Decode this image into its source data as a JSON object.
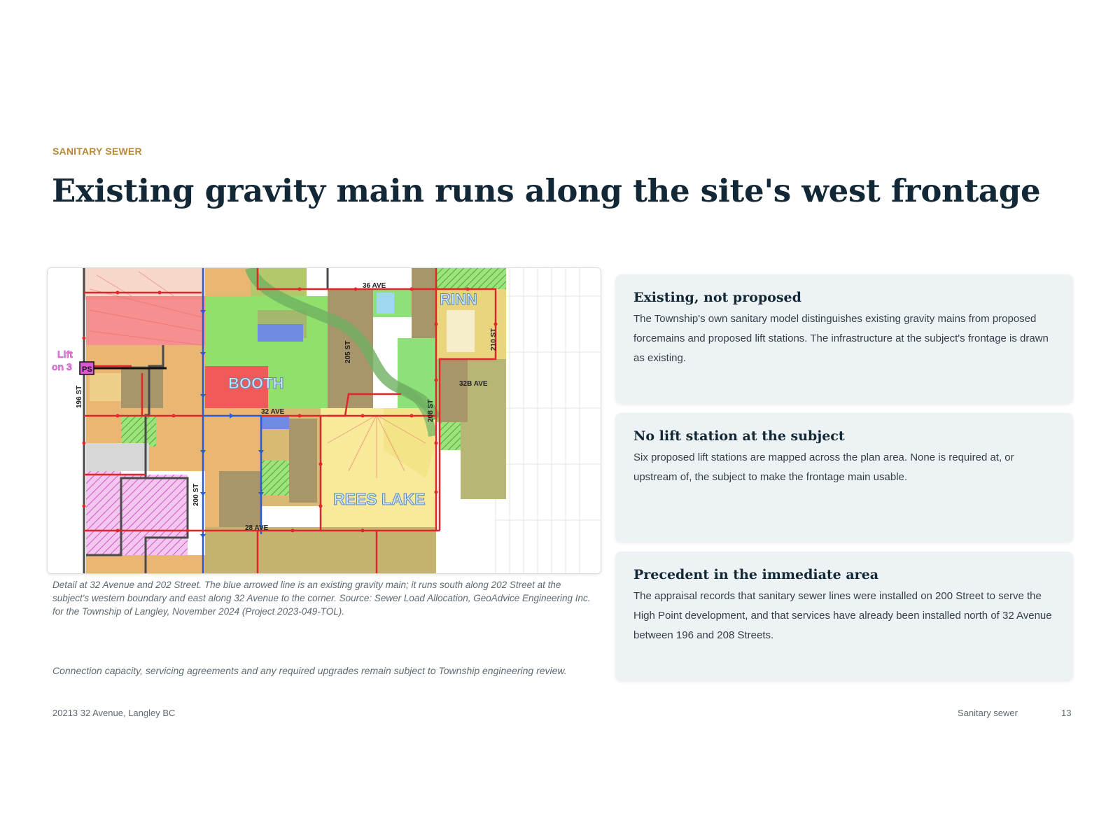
{
  "header": {
    "eyebrow": "SANITARY SEWER",
    "title": "Existing gravity main runs along the site's west frontage"
  },
  "map": {
    "labels": {
      "ave36": "36 AVE",
      "rinn": "RINN",
      "st210": "210 ST",
      "st205": "205 ST",
      "booth": "BOOTH",
      "ave32b": "32B AVE",
      "ave32": "32 AVE",
      "st208": "208 ST",
      "st196": "196 ST",
      "lift1": "Lift",
      "lift2": "on 3",
      "ps": "PS",
      "st200": "200 ST",
      "reesLake": "REES LAKE",
      "ave28": "28 AVE"
    },
    "caption": "Detail at 32 Avenue and 202 Street. The blue arrowed line is an existing gravity main; it runs south along 202 Street at the subject's western boundary and east along 32 Avenue to the corner. Source: Sewer Load Allocation, GeoAdvice Engineering Inc. for the Township of Langley, November 2024 (Project 2023-049-TOL)."
  },
  "footnote": "Connection capacity, servicing agreements and any required upgrades remain subject to Township engineering review.",
  "cards": [
    {
      "heading": "Existing, not proposed",
      "body": "The Township's own sanitary model distinguishes existing gravity mains from proposed forcemains and proposed lift stations. The infrastructure at the subject's frontage is drawn as existing."
    },
    {
      "heading": "No lift station at the subject",
      "body": "Six proposed lift stations are mapped across the plan area. None is required at, or upstream of, the subject to make the frontage main usable."
    },
    {
      "heading": "Precedent in the immediate area",
      "body": "The appraisal records that sanitary sewer lines were installed on 200 Street to serve the High Point development, and that services have already been installed north of 32 Avenue between 196 and 208 Streets."
    }
  ],
  "footer": {
    "address": "20213 32 Avenue, Langley BC",
    "section": "Sanitary sewer",
    "page": "13"
  },
  "colors": {
    "accent": "#b8893a",
    "title": "#132836",
    "card_bg": "#edf2f4",
    "gravity_main": "#2a5bd7",
    "proposed": "#e0262b"
  }
}
